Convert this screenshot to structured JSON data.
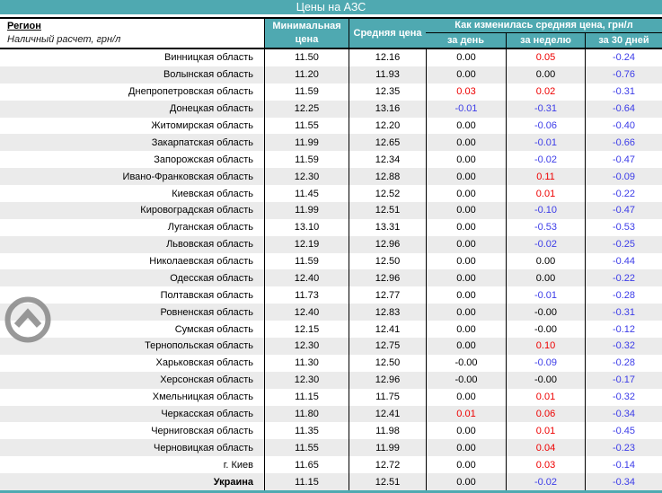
{
  "title": "Цены на АЗС",
  "table": {
    "region_header": "Регион",
    "region_subheader": "Наличный расчет, грн/л",
    "columns": {
      "min": "Минимальная цена",
      "avg": "Средняя цена",
      "change_group": "Как изменилась средняя цена, грн/л",
      "day": "за день",
      "week": "за неделю",
      "days30": "за 30 дней"
    }
  },
  "colors": {
    "teal": "#4fa9b1",
    "stripe": "#ebebeb",
    "value_black": "#000000",
    "value_red": "#ee0000",
    "value_blue": "#3c3ce8",
    "button_gray": "#8b8b8b"
  },
  "icons": {
    "scroll_top": "chevron-up-icon"
  },
  "rows": [
    {
      "region": "Винницкая область",
      "min": "11.50",
      "avg": "12.16",
      "day": "0.00",
      "day_color": "value_black",
      "week": "0.05",
      "week_color": "value_red",
      "days30": "-0.24",
      "days30_color": "value_blue",
      "bold": false
    },
    {
      "region": "Волынская область",
      "min": "11.20",
      "avg": "11.93",
      "day": "0.00",
      "day_color": "value_black",
      "week": "0.00",
      "week_color": "value_black",
      "days30": "-0.76",
      "days30_color": "value_blue",
      "bold": false
    },
    {
      "region": "Днепропетровская область",
      "min": "11.59",
      "avg": "12.35",
      "day": "0.03",
      "day_color": "value_red",
      "week": "0.02",
      "week_color": "value_red",
      "days30": "-0.31",
      "days30_color": "value_blue",
      "bold": false
    },
    {
      "region": "Донецкая область",
      "min": "12.25",
      "avg": "13.16",
      "day": "-0.01",
      "day_color": "value_blue",
      "week": "-0.31",
      "week_color": "value_blue",
      "days30": "-0.64",
      "days30_color": "value_blue",
      "bold": false
    },
    {
      "region": "Житомирская область",
      "min": "11.55",
      "avg": "12.20",
      "day": "0.00",
      "day_color": "value_black",
      "week": "-0.06",
      "week_color": "value_blue",
      "days30": "-0.40",
      "days30_color": "value_blue",
      "bold": false
    },
    {
      "region": "Закарпатская область",
      "min": "11.99",
      "avg": "12.65",
      "day": "0.00",
      "day_color": "value_black",
      "week": "-0.01",
      "week_color": "value_blue",
      "days30": "-0.66",
      "days30_color": "value_blue",
      "bold": false
    },
    {
      "region": "Запорожская область",
      "min": "11.59",
      "avg": "12.34",
      "day": "0.00",
      "day_color": "value_black",
      "week": "-0.02",
      "week_color": "value_blue",
      "days30": "-0.47",
      "days30_color": "value_blue",
      "bold": false
    },
    {
      "region": "Ивано-Франковская область",
      "min": "12.30",
      "avg": "12.88",
      "day": "0.00",
      "day_color": "value_black",
      "week": "0.11",
      "week_color": "value_red",
      "days30": "-0.09",
      "days30_color": "value_blue",
      "bold": false
    },
    {
      "region": "Киевская область",
      "min": "11.45",
      "avg": "12.52",
      "day": "0.00",
      "day_color": "value_black",
      "week": "0.01",
      "week_color": "value_red",
      "days30": "-0.22",
      "days30_color": "value_blue",
      "bold": false
    },
    {
      "region": "Кировоградская область",
      "min": "11.99",
      "avg": "12.51",
      "day": "0.00",
      "day_color": "value_black",
      "week": "-0.10",
      "week_color": "value_blue",
      "days30": "-0.47",
      "days30_color": "value_blue",
      "bold": false
    },
    {
      "region": "Луганская область",
      "min": "13.10",
      "avg": "13.31",
      "day": "0.00",
      "day_color": "value_black",
      "week": "-0.53",
      "week_color": "value_blue",
      "days30": "-0.53",
      "days30_color": "value_blue",
      "bold": false
    },
    {
      "region": "Львовская область",
      "min": "12.19",
      "avg": "12.96",
      "day": "0.00",
      "day_color": "value_black",
      "week": "-0.02",
      "week_color": "value_blue",
      "days30": "-0.25",
      "days30_color": "value_blue",
      "bold": false
    },
    {
      "region": "Николаевская область",
      "min": "11.59",
      "avg": "12.50",
      "day": "0.00",
      "day_color": "value_black",
      "week": "0.00",
      "week_color": "value_black",
      "days30": "-0.44",
      "days30_color": "value_blue",
      "bold": false
    },
    {
      "region": "Одесская область",
      "min": "12.40",
      "avg": "12.96",
      "day": "0.00",
      "day_color": "value_black",
      "week": "0.00",
      "week_color": "value_black",
      "days30": "-0.22",
      "days30_color": "value_blue",
      "bold": false
    },
    {
      "region": "Полтавская область",
      "min": "11.73",
      "avg": "12.77",
      "day": "0.00",
      "day_color": "value_black",
      "week": "-0.01",
      "week_color": "value_blue",
      "days30": "-0.28",
      "days30_color": "value_blue",
      "bold": false
    },
    {
      "region": "Ровненская область",
      "min": "12.40",
      "avg": "12.83",
      "day": "0.00",
      "day_color": "value_black",
      "week": "-0.00",
      "week_color": "value_black",
      "days30": "-0.31",
      "days30_color": "value_blue",
      "bold": false
    },
    {
      "region": "Сумская область",
      "min": "12.15",
      "avg": "12.41",
      "day": "0.00",
      "day_color": "value_black",
      "week": "-0.00",
      "week_color": "value_black",
      "days30": "-0.12",
      "days30_color": "value_blue",
      "bold": false
    },
    {
      "region": "Тернопольская область",
      "min": "12.30",
      "avg": "12.75",
      "day": "0.00",
      "day_color": "value_black",
      "week": "0.10",
      "week_color": "value_red",
      "days30": "-0.32",
      "days30_color": "value_blue",
      "bold": false
    },
    {
      "region": "Харьковская область",
      "min": "11.30",
      "avg": "12.50",
      "day": "-0.00",
      "day_color": "value_black",
      "week": "-0.09",
      "week_color": "value_blue",
      "days30": "-0.28",
      "days30_color": "value_blue",
      "bold": false
    },
    {
      "region": "Херсонская область",
      "min": "12.30",
      "avg": "12.96",
      "day": "-0.00",
      "day_color": "value_black",
      "week": "-0.00",
      "week_color": "value_black",
      "days30": "-0.17",
      "days30_color": "value_blue",
      "bold": false
    },
    {
      "region": "Хмельницкая область",
      "min": "11.15",
      "avg": "11.75",
      "day": "0.00",
      "day_color": "value_black",
      "week": "0.01",
      "week_color": "value_red",
      "days30": "-0.32",
      "days30_color": "value_blue",
      "bold": false
    },
    {
      "region": "Черкасская область",
      "min": "11.80",
      "avg": "12.41",
      "day": "0.01",
      "day_color": "value_red",
      "week": "0.06",
      "week_color": "value_red",
      "days30": "-0.34",
      "days30_color": "value_blue",
      "bold": false
    },
    {
      "region": "Черниговская область",
      "min": "11.35",
      "avg": "11.98",
      "day": "0.00",
      "day_color": "value_black",
      "week": "0.01",
      "week_color": "value_red",
      "days30": "-0.45",
      "days30_color": "value_blue",
      "bold": false
    },
    {
      "region": "Черновицкая область",
      "min": "11.55",
      "avg": "11.99",
      "day": "0.00",
      "day_color": "value_black",
      "week": "0.04",
      "week_color": "value_red",
      "days30": "-0.23",
      "days30_color": "value_blue",
      "bold": false
    },
    {
      "region": "г. Киев",
      "min": "11.65",
      "avg": "12.72",
      "day": "0.00",
      "day_color": "value_black",
      "week": "0.03",
      "week_color": "value_red",
      "days30": "-0.14",
      "days30_color": "value_blue",
      "bold": false
    },
    {
      "region": "Украина",
      "min": "11.15",
      "avg": "12.51",
      "day": "0.00",
      "day_color": "value_black",
      "week": "-0.02",
      "week_color": "value_blue",
      "days30": "-0.34",
      "days30_color": "value_blue",
      "bold": true
    }
  ]
}
